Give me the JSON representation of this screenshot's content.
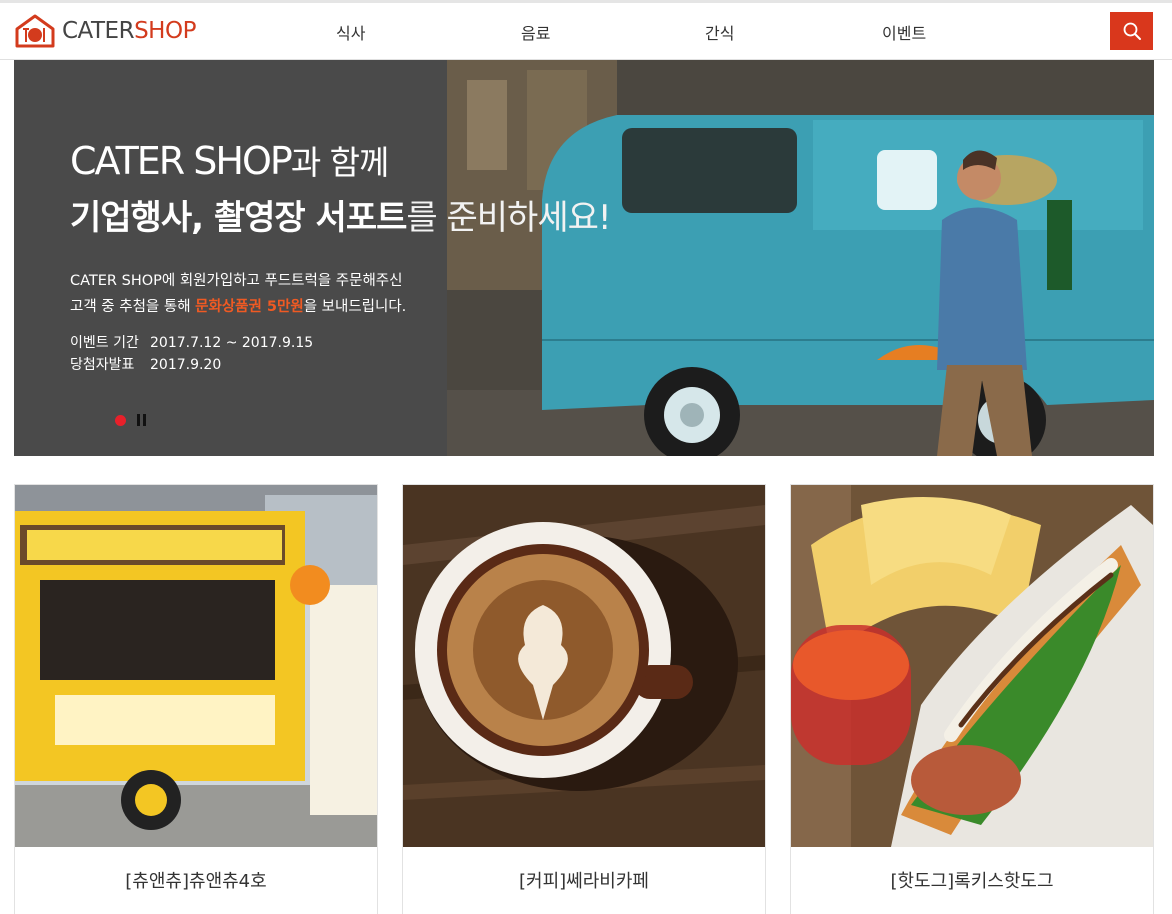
{
  "header": {
    "logo": {
      "word1": "CATER",
      "word2": "SHOP"
    },
    "nav": [
      {
        "label": "식사"
      },
      {
        "label": "음료"
      },
      {
        "label": "간식"
      },
      {
        "label": "이벤트"
      }
    ],
    "search_icon": "search-icon"
  },
  "hero": {
    "title_brand": "CATER SHOP",
    "title_suffix": "과 함께",
    "subtitle_bold": "기업행사, 촬영장 서포트",
    "subtitle_light": "를 준비하세요!",
    "desc_line1": "CATER SHOP에 회원가입하고 푸드트럭을 주문해주신",
    "desc_line2_pre": "고객 중 추첨을 통해 ",
    "desc_line2_highlight": "문화상품권 5만원",
    "desc_line2_post": "을 보내드립니다.",
    "period_label": "이벤트 기간",
    "period_value": "2017.7.12 ~ 2017.9.15",
    "announce_label": "당첨자발표",
    "announce_value": "2017.9.20",
    "highlight_color": "#f05a23"
  },
  "cards": [
    {
      "name": "[츄앤츄]츄앤츄4호"
    },
    {
      "name": "[커피]쎄라비카페"
    },
    {
      "name": "[핫도그]록키스핫도그"
    }
  ],
  "colors": {
    "accent": "#d9371c",
    "hero_panel": "#4a4a4a"
  }
}
